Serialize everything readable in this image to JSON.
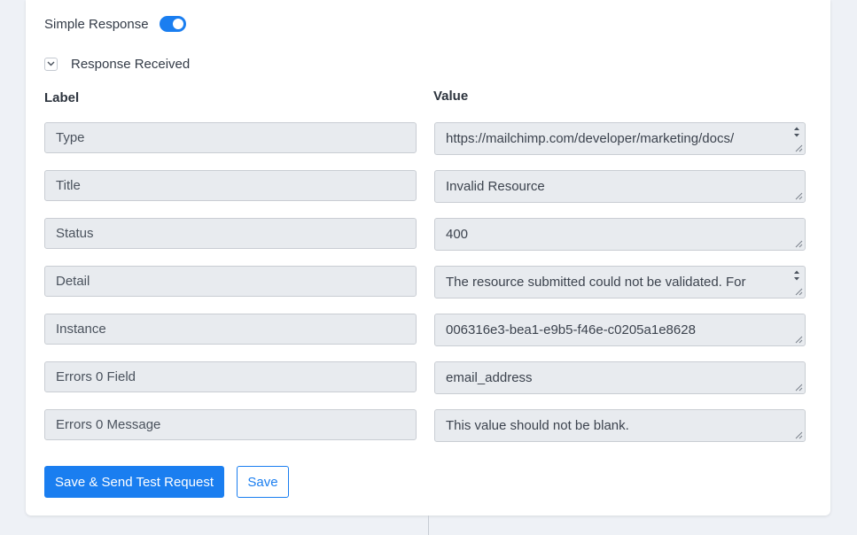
{
  "simple_response": {
    "label": "Simple Response",
    "enabled": true
  },
  "response_section": {
    "label": "Response Received",
    "expanded": true
  },
  "columns": {
    "label_header": "Label",
    "value_header": "Value"
  },
  "rows": [
    {
      "label": "Type",
      "value": "https://mailchimp.com/developer/marketing/docs/",
      "multiline": true
    },
    {
      "label": "Title",
      "value": "Invalid Resource",
      "multiline": false
    },
    {
      "label": "Status",
      "value": "400",
      "multiline": false
    },
    {
      "label": "Detail",
      "value": "The resource submitted could not be validated. For",
      "multiline": true
    },
    {
      "label": "Instance",
      "value": "006316e3-bea1-e9b5-f46e-c0205a1e8628",
      "multiline": false
    },
    {
      "label": "Errors 0 Field",
      "value": "email_address",
      "multiline": false
    },
    {
      "label": "Errors 0 Message",
      "value": "This value should not be blank.",
      "multiline": false
    }
  ],
  "buttons": {
    "send_label": "Save & Send Test Request",
    "save_label": "Save"
  },
  "colors": {
    "accent": "#1a7ef0",
    "field_bg": "#e8ebef",
    "page_bg": "#eef1f6"
  }
}
